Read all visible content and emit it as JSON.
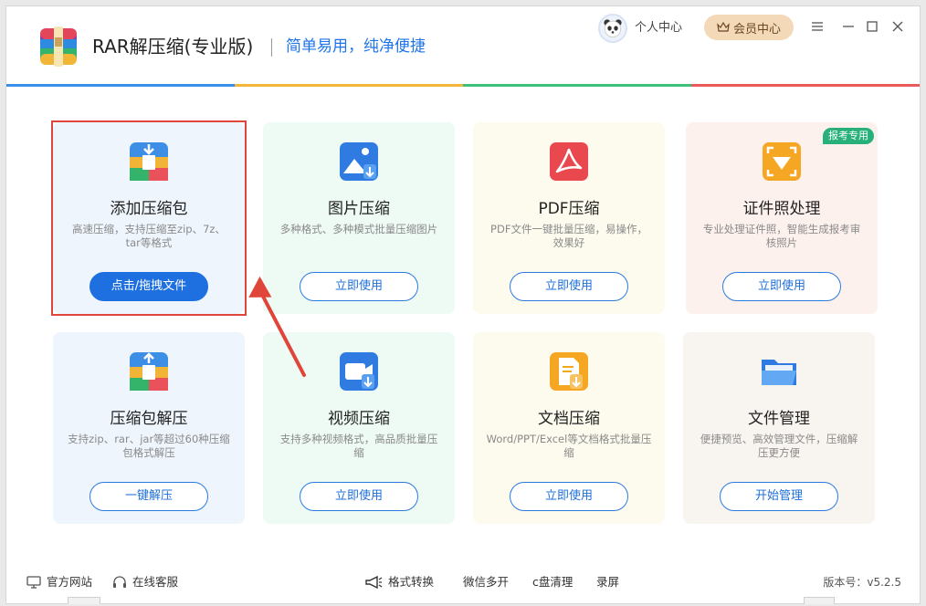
{
  "header": {
    "app_title": "RAR解压缩(专业版)",
    "slogan": "简单易用，纯净便捷",
    "personal_center": "个人中心",
    "member_center": "会员中心",
    "accent_color": "#1e74e8",
    "bar_colors": [
      "#3a8fe8",
      "#f3b63a",
      "#3cc07a",
      "#ea5a5a"
    ]
  },
  "cards": [
    {
      "title": "添加压缩包",
      "desc": "高速压缩，支持压缩至zip、7z、tar等格式",
      "button": "点击/拖拽文件",
      "icon": "archive-add-icon",
      "bg": "#eef5fd"
    },
    {
      "title": "图片压缩",
      "desc": "多种格式、多种模式批量压缩图片",
      "button": "立即使用",
      "icon": "image-compress-icon",
      "bg": "#eefaf4"
    },
    {
      "title": "PDF压缩",
      "desc": "PDF文件一键批量压缩，易操作，效果好",
      "button": "立即使用",
      "icon": "pdf-icon",
      "bg": "#fdfbee"
    },
    {
      "title": "证件照处理",
      "desc": "专业处理证件照，智能生成报考审核照片",
      "button": "立即使用",
      "icon": "id-photo-icon",
      "bg": "#fdf1ee",
      "badge": "报考专用"
    },
    {
      "title": "压缩包解压",
      "desc": "支持zip、rar、jar等超过60种压缩包格式解压",
      "button": "一键解压",
      "icon": "archive-extract-icon",
      "bg": "#eef5fd"
    },
    {
      "title": "视频压缩",
      "desc": "支持多种视频格式，高品质批量压缩",
      "button": "立即使用",
      "icon": "video-compress-icon",
      "bg": "#eefaf4"
    },
    {
      "title": "文档压缩",
      "desc": "Word/PPT/Excel等文档格式批量压缩",
      "button": "立即使用",
      "icon": "document-compress-icon",
      "bg": "#fdfbee"
    },
    {
      "title": "文件管理",
      "desc": "便捷预览、高效管理文件，压缩解压更方便",
      "button": "开始管理",
      "icon": "folder-icon",
      "bg": "#f8f4ef"
    }
  ],
  "footer": {
    "official_site": "官方网站",
    "online_service": "在线客服",
    "format_convert": "格式转换",
    "wechat_multi": "微信多开",
    "c_drive_clean": "c盘清理",
    "screen_record": "录屏",
    "version": "版本号：v5.2.5"
  }
}
